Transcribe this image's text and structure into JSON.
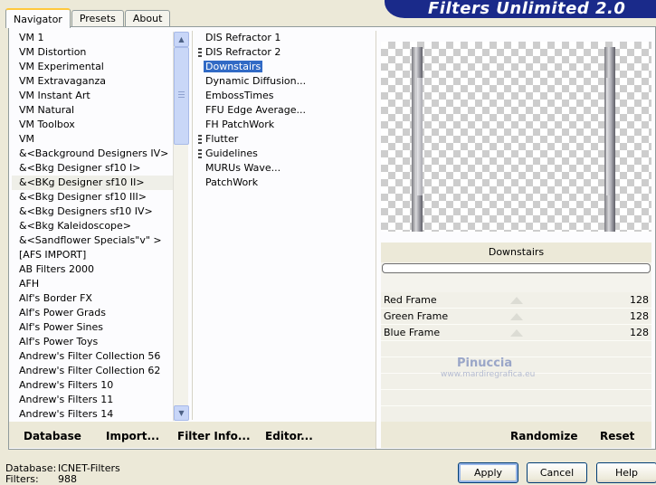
{
  "tabs": [
    "Navigator",
    "Presets",
    "About"
  ],
  "banner_title": "Filters Unlimited 2.0",
  "categories": [
    "VM 1",
    "VM Distortion",
    "VM Experimental",
    "VM Extravaganza",
    "VM Instant Art",
    "VM Natural",
    "VM Toolbox",
    "VM",
    "&<Background Designers IV>",
    "&<Bkg Designer sf10 I>",
    "&<BKg Designer sf10 II>",
    "&<Bkg Designer sf10 III>",
    "&<Bkg Designers sf10 IV>",
    "&<Bkg Kaleidoscope>",
    "&<Sandflower Specials\"v\" >",
    "[AFS IMPORT]",
    "AB Filters 2000",
    "AFH",
    "Alf's Border FX",
    "Alf's Power Grads",
    "Alf's Power Sines",
    "Alf's Power Toys",
    "Andrew's Filter Collection 56",
    "Andrew's Filter Collection 62",
    "Andrew's Filters 10",
    "Andrew's Filters 11",
    "Andrew's Filters 14"
  ],
  "selected_category_index": 10,
  "filters": [
    {
      "label": "DIS Refractor 1",
      "group": false
    },
    {
      "label": "DIS Refractor 2",
      "group": true
    },
    {
      "label": "Downstairs",
      "group": false
    },
    {
      "label": "Dynamic Diffusion...",
      "group": false
    },
    {
      "label": "EmbossTimes",
      "group": false
    },
    {
      "label": "FFU Edge Average...",
      "group": false
    },
    {
      "label": "FH PatchWork",
      "group": false
    },
    {
      "label": "Flutter",
      "group": true
    },
    {
      "label": "Guidelines",
      "group": true
    },
    {
      "label": "MURUs Wave...",
      "group": false
    },
    {
      "label": "PatchWork",
      "group": false
    }
  ],
  "selected_filter_index": 2,
  "filter_title": "Downstairs",
  "params": [
    {
      "name": "Red Frame",
      "value": "128"
    },
    {
      "name": "Green Frame",
      "value": "128"
    },
    {
      "name": "Blue Frame",
      "value": "128"
    }
  ],
  "watermark": {
    "name": "Pinuccia",
    "site": "www.mardiregrafica.eu"
  },
  "toolbar": {
    "database": "Database",
    "import": "Import...",
    "filter_info": "Filter Info...",
    "editor": "Editor...",
    "randomize": "Randomize",
    "reset": "Reset"
  },
  "info": {
    "database_label": "Database:",
    "database_value": "ICNET-Filters",
    "filters_label": "Filters:",
    "filters_value": "988"
  },
  "buttons": {
    "apply": "Apply",
    "cancel": "Cancel",
    "help": "Help"
  },
  "colors": {
    "selection": "#316ac5",
    "banner": "#1a2a8a",
    "window": "#ece9d8"
  }
}
